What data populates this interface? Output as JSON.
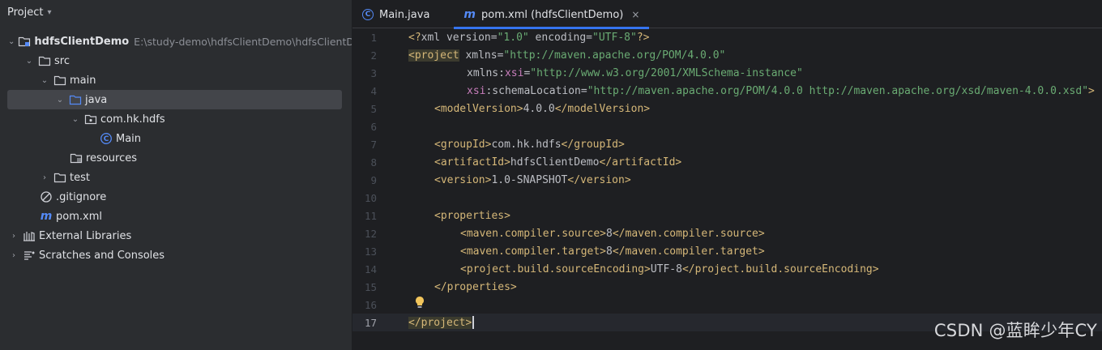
{
  "project_panel": {
    "title": "Project",
    "tree": [
      {
        "id": "root",
        "label": "hdfsClientDemo",
        "path": "E:\\study-demo\\hdfsClientDemo\\hdfsClientDe",
        "icon": "module-folder-icon",
        "expanded": true
      },
      {
        "id": "src",
        "label": "src",
        "icon": "folder-icon",
        "expanded": true
      },
      {
        "id": "main",
        "label": "main",
        "icon": "folder-icon",
        "expanded": true
      },
      {
        "id": "java",
        "label": "java",
        "icon": "source-folder-icon",
        "expanded": true,
        "selected": true
      },
      {
        "id": "package",
        "label": "com.hk.hdfs",
        "icon": "package-icon",
        "expanded": true
      },
      {
        "id": "main-class",
        "label": "Main",
        "icon": "class-icon"
      },
      {
        "id": "resources",
        "label": "resources",
        "icon": "resources-folder-icon"
      },
      {
        "id": "test",
        "label": "test",
        "icon": "folder-icon",
        "expanded": false
      },
      {
        "id": "gitignore",
        "label": ".gitignore",
        "icon": "ignore-file-icon"
      },
      {
        "id": "pom",
        "label": "pom.xml",
        "icon": "maven-icon"
      },
      {
        "id": "ext-libs",
        "label": "External Libraries",
        "icon": "library-icon",
        "expanded": false
      },
      {
        "id": "scratches",
        "label": "Scratches and Consoles",
        "icon": "scratches-icon",
        "expanded": false
      }
    ]
  },
  "editor": {
    "tabs": [
      {
        "label": "Main.java",
        "icon": "class-icon",
        "active": false
      },
      {
        "label": "pom.xml (hdfsClientDemo)",
        "icon": "maven-icon",
        "active": true,
        "close": "×"
      }
    ],
    "current_line": 17,
    "line_numbers": [
      "1",
      "2",
      "3",
      "4",
      "5",
      "6",
      "7",
      "8",
      "9",
      "10",
      "11",
      "12",
      "13",
      "14",
      "15",
      "16",
      "17"
    ],
    "code": {
      "l1_pi_open": "<?",
      "l1_xml": "xml ",
      "l1_version_attr": "version=",
      "l1_version_val": "\"1.0\"",
      "l1_encoding_attr": " encoding=",
      "l1_encoding_val": "\"UTF-8\"",
      "l1_pi_close": "?>",
      "l2_open": "<project",
      "l2_attr": " xmlns=",
      "l2_val": "\"http://maven.apache.org/POM/4.0.0\"",
      "l3_attr": "xmlns:",
      "l3_ns": "xsi",
      "l3_eq": "=",
      "l3_val": "\"http://www.w3.org/2001/XMLSchema-instance\"",
      "l4_ns": "xsi",
      "l4_attr": ":schemaLocation=",
      "l4_val": "\"http://maven.apache.org/POM/4.0.0 http://maven.apache.org/xsd/maven-4.0.0.xsd\"",
      "l4_close": ">",
      "l5_open": "<modelVersion>",
      "l5_text": "4.0.0",
      "l5_close": "</modelVersion>",
      "l7_open": "<groupId>",
      "l7_text": "com.hk.hdfs",
      "l7_close": "</groupId>",
      "l8_open": "<artifactId>",
      "l8_text": "hdfsClientDemo",
      "l8_close": "</artifactId>",
      "l9_open": "<version>",
      "l9_text": "1.0-SNAPSHOT",
      "l9_close": "</version>",
      "l11_open": "<properties>",
      "l12_open": "<maven.compiler.source>",
      "l12_text": "8",
      "l12_close": "</maven.compiler.source>",
      "l13_open": "<maven.compiler.target>",
      "l13_text": "8",
      "l13_close": "</maven.compiler.target>",
      "l14_open": "<project.build.sourceEncoding>",
      "l14_text": "UTF-8",
      "l14_close": "</project.build.sourceEncoding>",
      "l15_close": "</properties>",
      "l17_close": "</project>"
    }
  },
  "watermark": "CSDN @蓝眸少年CY",
  "colors": {
    "accent": "#3574f0",
    "tag": "#d5b778",
    "string": "#6aab73",
    "namespace": "#c77dbb",
    "text": "#bcbec4"
  }
}
